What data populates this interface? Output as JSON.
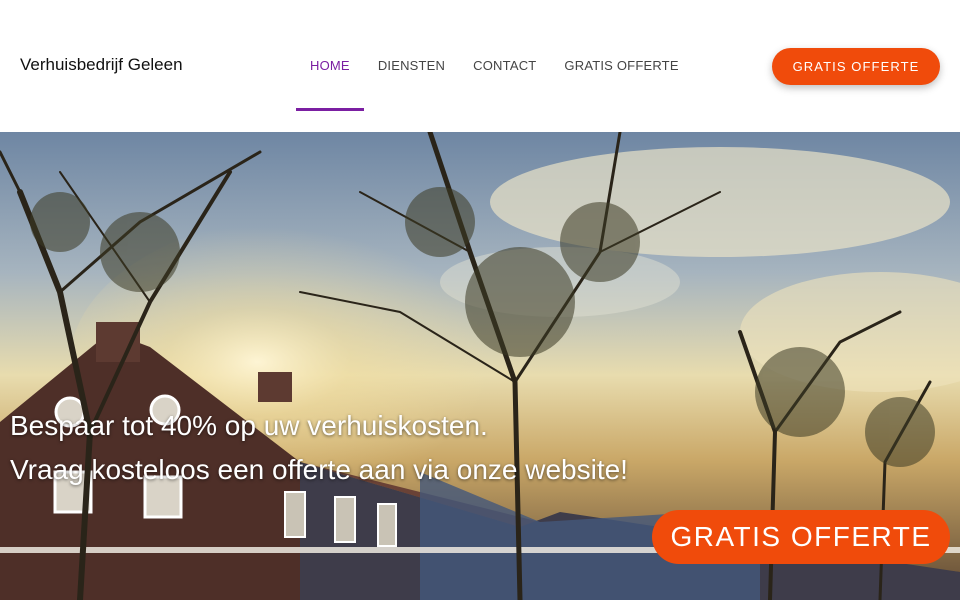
{
  "header": {
    "brand": "Verhuisbedrijf Geleen",
    "nav": [
      {
        "label": "HOME",
        "active": true
      },
      {
        "label": "DIENSTEN",
        "active": false
      },
      {
        "label": "CONTACT",
        "active": false
      },
      {
        "label": "GRATIS OFFERTE",
        "active": false
      }
    ],
    "cta_label": "GRATIS OFFERTE"
  },
  "hero": {
    "line1": "Bespaar tot 40% op uw verhuiskosten.",
    "line2": "Vraag kosteloos een offerte aan via onze website!",
    "cta_label": "GRATIS OFFERTE",
    "image_description": "street-houses-trees-sunset-photo"
  },
  "colors": {
    "accent": "#f04b0b",
    "nav_active": "#7b1fa2",
    "nav_text": "#444444"
  }
}
